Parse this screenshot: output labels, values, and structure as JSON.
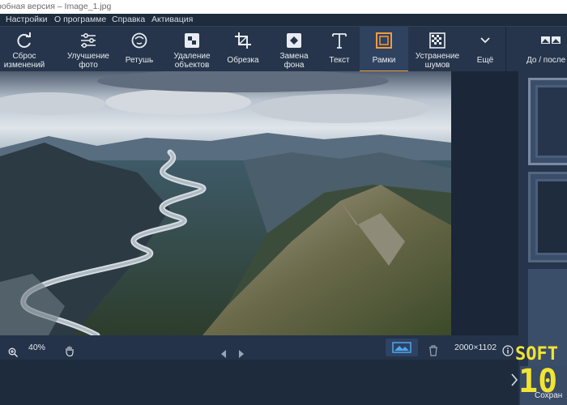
{
  "window": {
    "title": "робная версия – Image_1.jpg"
  },
  "menu": [
    {
      "label": "Настройки"
    },
    {
      "label": "О программе"
    },
    {
      "label": "Справка"
    },
    {
      "label": "Активация"
    }
  ],
  "toolbar": {
    "tools": [
      {
        "label": "Сброс\nизменений",
        "icon": "reset-icon"
      },
      {
        "label": "Улучшение\nфото",
        "icon": "sliders-icon"
      },
      {
        "label": "Ретушь",
        "icon": "retouch-face-icon"
      },
      {
        "label": "Удаление\nобъектов",
        "icon": "remove-objects-icon"
      },
      {
        "label": "Обрезка",
        "icon": "crop-icon"
      },
      {
        "label": "Замена\nфона",
        "icon": "background-icon"
      },
      {
        "label": "Текст",
        "icon": "text-icon"
      },
      {
        "label": "Рамки",
        "icon": "frame-icon",
        "active": true
      },
      {
        "label": "Устранение\nшумов",
        "icon": "denoise-icon"
      },
      {
        "label": "Ещё",
        "icon": "chevron-down-icon"
      },
      {
        "label": "До / после",
        "icon": "before-after-icon"
      }
    ],
    "accent": "#f19a3e"
  },
  "status": {
    "zoom": "40%",
    "dimensions": "2000×1102"
  },
  "watermark": {
    "text_top": "SOFT",
    "text_bottom": "10"
  },
  "save_label": "Сохран"
}
